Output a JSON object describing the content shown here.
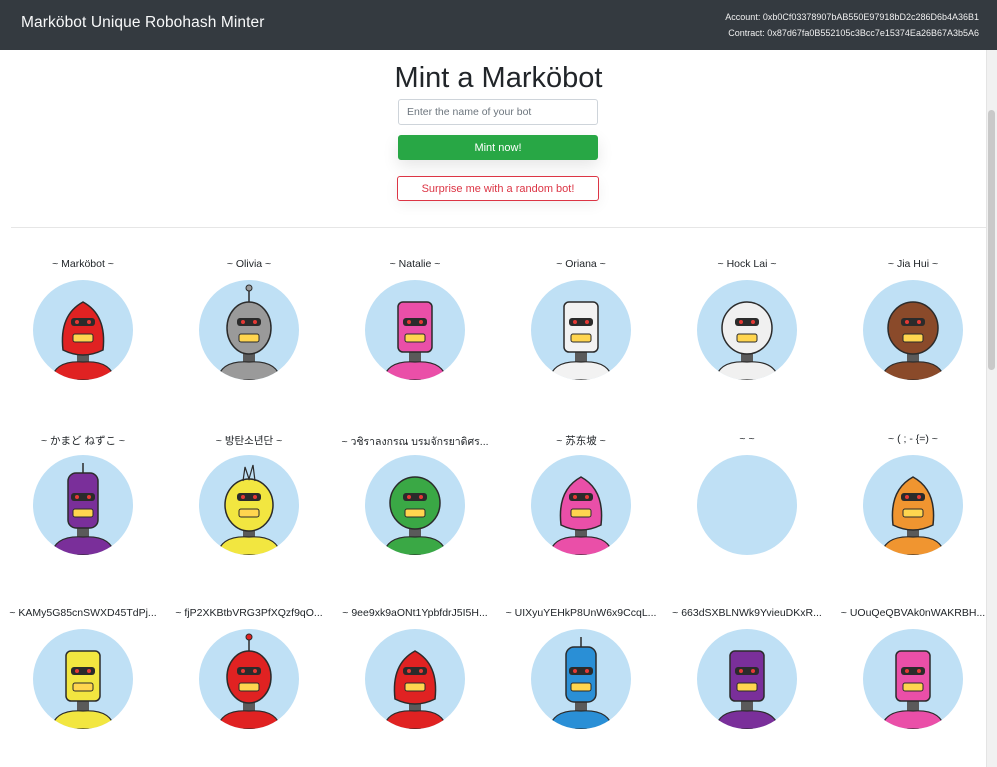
{
  "app": {
    "title": "Marköbot Unique Robohash Minter"
  },
  "account": {
    "account_text": "Account: 0xb0Cf03378907bAB550E97918bD2c286D6b4A36B1",
    "contract_text": "Contract: 0x87d67fa0B552105c3Bcc7e15374Ea26B67A3b5A6"
  },
  "mint": {
    "heading": "Mint a Marköbot",
    "input_placeholder": "Enter the name of your bot",
    "input_value": "",
    "mint_label": "Mint now!",
    "random_label": "Surprise me with a random bot!"
  },
  "bots": [
    {
      "name": "~ Marköbot ~",
      "color": "#e02222",
      "shape": "drop"
    },
    {
      "name": "~ Olivia ~",
      "color": "#9a9a9a",
      "shape": "antenna"
    },
    {
      "name": "~ Natalie ~",
      "color": "#ea4fa8",
      "shape": "box"
    },
    {
      "name": "~ Oriana ~",
      "color": "#f2f2f2",
      "shape": "can"
    },
    {
      "name": "~ Hock Lai ~",
      "color": "#f0f0f0",
      "shape": "dome"
    },
    {
      "name": "~ Jia Hui ~",
      "color": "#8a4a2a",
      "shape": "round"
    },
    {
      "name": "~ かまど ねずこ ~",
      "color": "#7a2f9a",
      "shape": "tall"
    },
    {
      "name": "~ 방탄소년단 ~",
      "color": "#f2e640",
      "shape": "spiky"
    },
    {
      "name": "~ วชิราลงกรณ บรมจักรยาดิศร...",
      "color": "#3aa845",
      "shape": "round"
    },
    {
      "name": "~ 苏东坡 ~",
      "color": "#ea4fa8",
      "shape": "drop"
    },
    {
      "name": "~ ~",
      "color": "",
      "shape": "none"
    },
    {
      "name": "~ ( ; - {=) ~",
      "color": "#f09530",
      "shape": "drop"
    },
    {
      "name": "~ KAMy5G85cnSWXD45TdPj...",
      "color": "#f2e640",
      "shape": "box"
    },
    {
      "name": "~ fjP2XKBtbVRG3PfXQzf9qO...",
      "color": "#e02222",
      "shape": "antenna2"
    },
    {
      "name": "~ 9ee9xk9aONt1YpbfdrJ5I5H...",
      "color": "#e02222",
      "shape": "drop"
    },
    {
      "name": "~ UIXyuYEHkP8UnW6x9CcqL...",
      "color": "#2a8fd6",
      "shape": "tall"
    },
    {
      "name": "~ 663dSXBLNWk9YvieuDKxR...",
      "color": "#7a2f9a",
      "shape": "can"
    },
    {
      "name": "~ UOuQeQBVAk0nWAKRBH...",
      "color": "#ea4fa8",
      "shape": "can"
    }
  ]
}
